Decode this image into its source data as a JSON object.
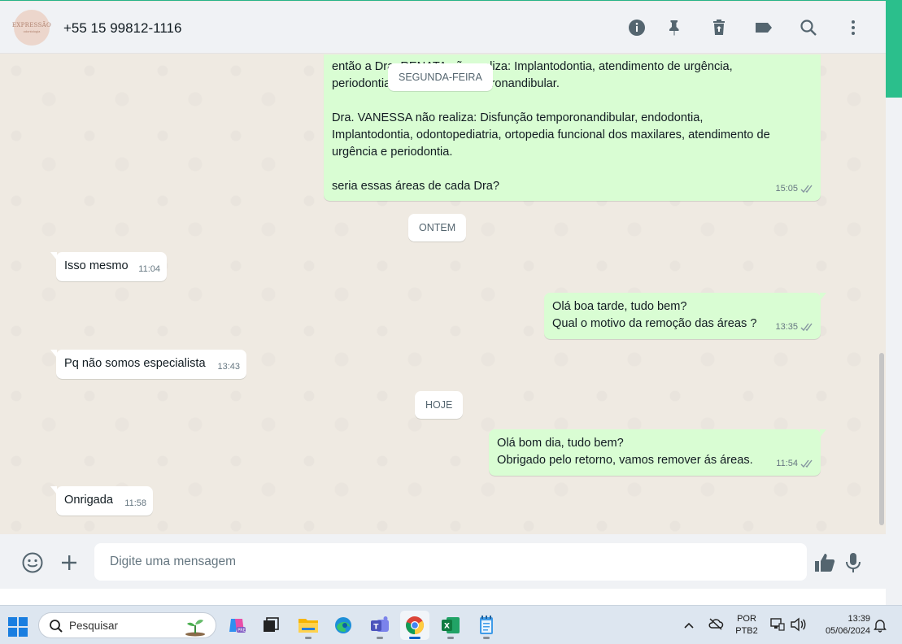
{
  "header": {
    "avatar_text": "EXPRESSÃO",
    "avatar_subtext": "odontologia",
    "contact_name": "+55 15 99812-1116",
    "icons": [
      "info-icon",
      "pin-icon",
      "delete-icon",
      "label-icon",
      "search-icon",
      "more-icon"
    ]
  },
  "chat": {
    "sticky_date": "SEGUNDA-FEIRA",
    "messages": [
      {
        "dir": "out",
        "text": "então a Dra. RENATA não realiza: Implantodontia, atendimento de urgência,\nperiodontia e disfunção temporonandibular.\n\nDra. VANESSA não realiza: Disfunção temporonandibular, endodontia,\nImplantodontia, odontopediatria, ortopedia funcional dos maxilares, atendimento de\nurgência e periodontia.\n\nseria essas áreas de cada Dra?",
        "time": "15:05"
      },
      {
        "dir": "in",
        "text": "Isso mesmo",
        "time": "11:04"
      },
      {
        "dir": "out",
        "text": "Olá boa tarde, tudo bem?\nQual o motivo da remoção das áreas ?",
        "time": "13:35"
      },
      {
        "dir": "in",
        "text": "Pq não somos especialista",
        "time": "13:43"
      },
      {
        "dir": "out",
        "text": "Olá bom dia, tudo bem?\nObrigado pelo retorno, vamos remover ás áreas.",
        "time": "11:54"
      },
      {
        "dir": "in",
        "text": "Onrigada",
        "time": "11:58"
      }
    ],
    "dates": [
      "ONTEM",
      "HOJE"
    ]
  },
  "composer": {
    "placeholder": "Digite uma mensagem"
  },
  "taskbar": {
    "search_label": "Pesquisar",
    "lang_top": "POR",
    "lang_bottom": "PTB2",
    "time": "13:39",
    "date": "05/06/2024"
  },
  "colors": {
    "outgoing_bubble": "#d9fdd3",
    "incoming_bubble": "#ffffff",
    "chat_bg": "#efeae2",
    "read_ticks": "#8696a0"
  }
}
